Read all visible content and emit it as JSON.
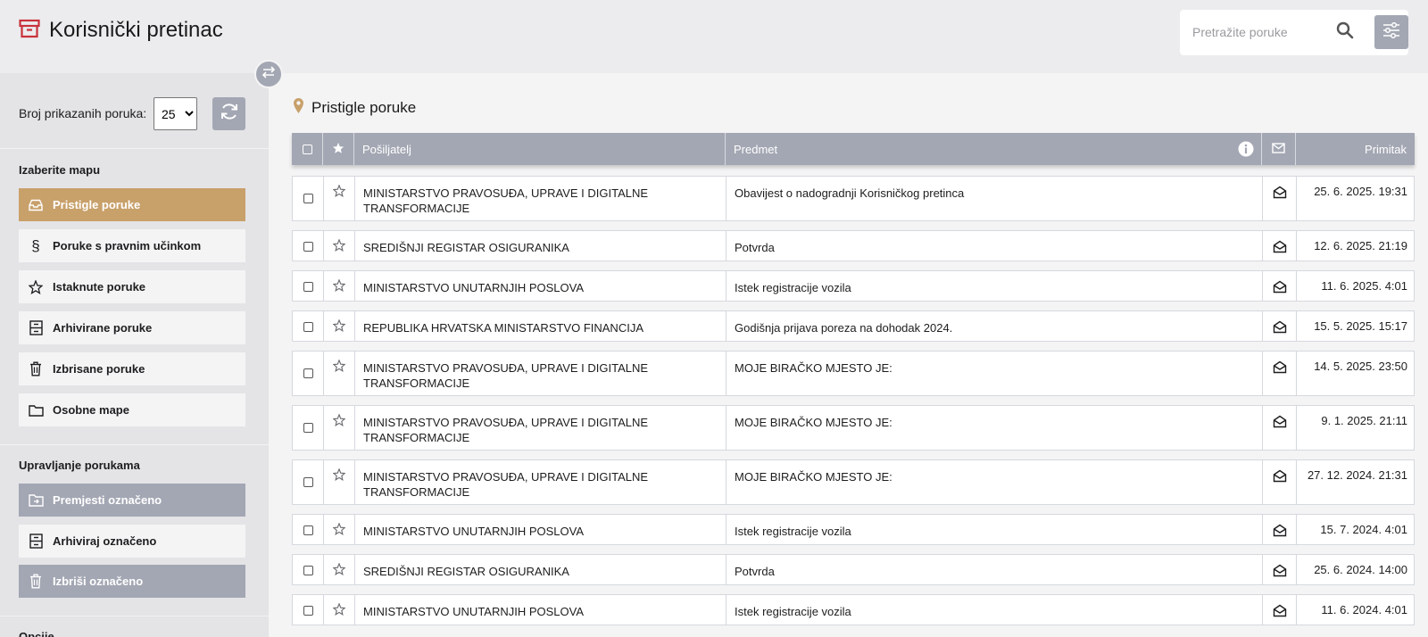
{
  "header": {
    "app_title": "Korisnički pretinac",
    "search_placeholder": "Pretražite poruke"
  },
  "sidebar": {
    "count_label": "Broj prikazanih poruka:",
    "count_value": "25",
    "count_options": [
      "25"
    ],
    "folders_title": "Izaberite mapu",
    "folders": [
      {
        "label": "Pristigle poruke",
        "icon": "inbox-icon"
      },
      {
        "label": "Poruke s pravnim učinkom",
        "icon": "section-sign-icon"
      },
      {
        "label": "Istaknute poruke",
        "icon": "star-icon"
      },
      {
        "label": "Arhivirane poruke",
        "icon": "archive-icon"
      },
      {
        "label": "Izbrisane poruke",
        "icon": "trash-icon"
      },
      {
        "label": "Osobne mape",
        "icon": "folder-icon"
      }
    ],
    "actions_title": "Upravljanje porukama",
    "actions": [
      {
        "label": "Premjesti označeno",
        "icon": "move-folder-icon"
      },
      {
        "label": "Arhiviraj označeno",
        "icon": "archive-icon"
      },
      {
        "label": "Izbriši označeno",
        "icon": "trash-icon"
      }
    ],
    "options_title": "Opcije"
  },
  "main": {
    "title": "Pristigle poruke",
    "columns": {
      "sender": "Pošiljatelj",
      "subject": "Predmet",
      "received": "Primitak"
    },
    "rows": [
      {
        "sender": "MINISTARSTVO PRAVOSUĐA, UPRAVE I DIGITALNE TRANSFORMACIJE",
        "subject": "Obavijest o nadogradnji Korisničkog pretinca",
        "date": "25. 6. 2025. 19:31"
      },
      {
        "sender": "SREDIŠNJI REGISTAR OSIGURANIKA",
        "subject": "Potvrda",
        "date": "12. 6. 2025. 21:19"
      },
      {
        "sender": "MINISTARSTVO UNUTARNJIH POSLOVA",
        "subject": "Istek registracije vozila",
        "date": "11. 6. 2025. 4:01"
      },
      {
        "sender": "REPUBLIKA HRVATSKA MINISTARSTVO FINANCIJA",
        "subject": "Godišnja prijava poreza na dohodak 2024.",
        "date": "15. 5. 2025. 15:17"
      },
      {
        "sender": "MINISTARSTVO PRAVOSUĐA, UPRAVE I DIGITALNE TRANSFORMACIJE",
        "subject": "MOJE BIRAČKO MJESTO JE:",
        "date": "14. 5. 2025. 23:50"
      },
      {
        "sender": "MINISTARSTVO PRAVOSUĐA, UPRAVE I DIGITALNE TRANSFORMACIJE",
        "subject": "MOJE BIRAČKO MJESTO JE:",
        "date": "9. 1. 2025. 21:11"
      },
      {
        "sender": "MINISTARSTVO PRAVOSUĐA, UPRAVE I DIGITALNE TRANSFORMACIJE",
        "subject": "MOJE BIRAČKO MJESTO JE:",
        "date": "27. 12. 2024. 21:31"
      },
      {
        "sender": "MINISTARSTVO UNUTARNJIH POSLOVA",
        "subject": "Istek registracije vozila",
        "date": "15. 7. 2024. 4:01"
      },
      {
        "sender": "SREDIŠNJI REGISTAR OSIGURANIKA",
        "subject": "Potvrda",
        "date": "25. 6. 2024. 14:00"
      },
      {
        "sender": "MINISTARSTVO UNUTARNJIH POSLOVA",
        "subject": "Istek registracije vozila",
        "date": "11. 6. 2024. 4:01"
      }
    ]
  },
  "colors": {
    "brand_red": "#c8323c",
    "active_folder": "#c8a06a",
    "header_gray": "#a3a7b3",
    "pin_accent": "#c8a06a"
  }
}
